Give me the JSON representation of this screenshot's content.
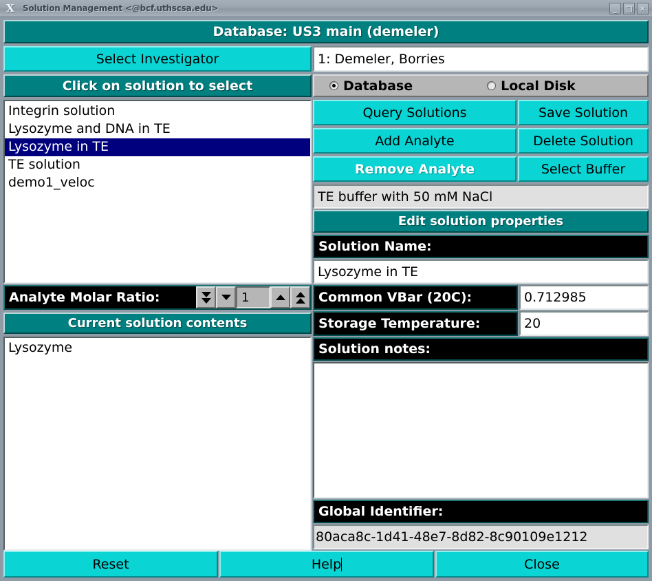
{
  "window": {
    "title": "Solution Management <@bcf.uthscsa.edu>",
    "x_logo": "X",
    "minimize": "_",
    "maximize": "□",
    "close": "×"
  },
  "header": {
    "database_banner": "Database: US3 main (demeler)"
  },
  "left": {
    "select_investigator_button": "Select Investigator",
    "click_solution_header": "Click on solution to select",
    "solutions": [
      {
        "label": "Integrin solution",
        "selected": false
      },
      {
        "label": "Lysozyme and DNA in TE",
        "selected": false
      },
      {
        "label": "Lysozyme in TE",
        "selected": true
      },
      {
        "label": "TE solution",
        "selected": false
      },
      {
        "label": "demo1_veloc",
        "selected": false
      }
    ],
    "molar_ratio_label": "Analyte Molar Ratio:",
    "molar_ratio_value": "1",
    "current_contents_header": "Current solution contents",
    "contents": [
      {
        "label": "Lysozyme"
      }
    ]
  },
  "right": {
    "investigator_value": "1: Demeler, Borries",
    "source": {
      "database_label": "Database",
      "database_selected": true,
      "local_disk_label": "Local Disk",
      "local_disk_selected": false
    },
    "buttons": {
      "query_solutions": "Query Solutions",
      "save_solution": "Save Solution",
      "add_analyte": "Add Analyte",
      "delete_solution": "Delete Solution",
      "remove_analyte": "Remove Analyte",
      "select_buffer": "Select Buffer"
    },
    "buffer_value": "TE buffer with 50 mM NaCl",
    "edit_properties_header": "Edit solution properties",
    "solution_name_label": "Solution Name:",
    "solution_name_value": "Lysozyme in TE",
    "common_vbar_label": "Common VBar (20C):",
    "common_vbar_value": "0.712985",
    "storage_temperature_label": "Storage Temperature:",
    "storage_temperature_value": "20",
    "solution_notes_label": "Solution notes:",
    "solution_notes_value": "",
    "global_identifier_label": "Global Identifier:",
    "global_identifier_value": "80aca8c-1d41-48e7-8d82-8c90109e1212"
  },
  "footer": {
    "reset": "Reset",
    "help": "Help",
    "close": "Close"
  },
  "colors": {
    "teal": "#008080",
    "cyan": "#0ad4d4",
    "selection_blue": "#00007f",
    "panel_gray": "#8f9ba6"
  }
}
